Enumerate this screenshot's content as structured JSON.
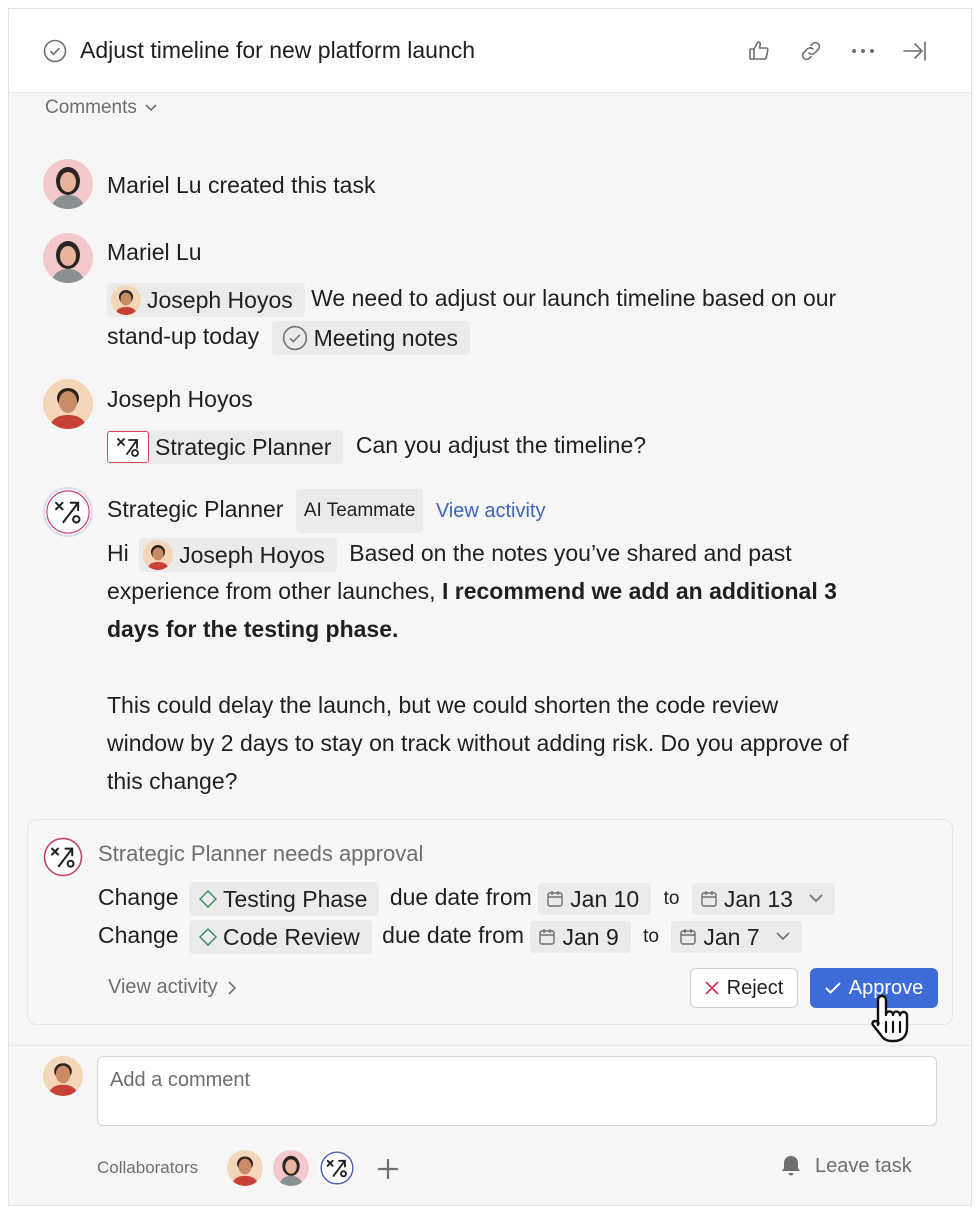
{
  "header": {
    "title": "Adjust timeline for new platform launch",
    "icons": [
      "check-circle-icon",
      "thumbs-up-icon",
      "link-icon",
      "more-icon",
      "close-pane-icon"
    ]
  },
  "comments_toggle": {
    "label": "Comments"
  },
  "feed": {
    "created": {
      "author": "Mariel Lu",
      "text": "Mariel Lu created this task"
    },
    "comment1": {
      "author": "Mariel Lu",
      "mention": "Joseph Hoyos",
      "text_a": "We need to adjust our launch timeline based on our",
      "text_b": "stand-up today",
      "attachment": "Meeting notes"
    },
    "comment2": {
      "author": "Joseph Hoyos",
      "mention": "Strategic Planner",
      "text": "Can you adjust the timeline?"
    },
    "comment3": {
      "author": "Strategic Planner",
      "badge": "AI Teammate",
      "link": "View activity",
      "greeting": "Hi",
      "mention": "Joseph Hoyos",
      "text_a": "Based on the notes you’ve shared and past",
      "text_b": "experience from other launches,",
      "bold_a": "I recommend we add an additional 3",
      "bold_b": "days for the testing phase.",
      "para2_a": "This could delay the launch, but we could shorten the code review",
      "para2_b": "window by 2 days to stay on track without adding risk. Do you approve of",
      "para2_c": "this change?"
    }
  },
  "approval": {
    "agent": "Strategic Planner",
    "status": "needs approval",
    "rows": [
      {
        "verb": "Change",
        "item": "Testing Phase",
        "middle": "due date from",
        "from": "Jan 10",
        "to_word": "to",
        "to": "Jan 13"
      },
      {
        "verb": "Change",
        "item": "Code Review",
        "middle": "due date from",
        "from": "Jan 9",
        "to_word": "to",
        "to": "Jan 7"
      }
    ],
    "view_activity": "View activity",
    "reject": "Reject",
    "approve": "Approve",
    "colors": {
      "approve_bg": "#3f6bd6",
      "reject_x": "#d1395a",
      "link": "#3e64b6"
    }
  },
  "composer": {
    "placeholder": "Add a comment",
    "collaborators_label": "Collaborators",
    "leave": "Leave task"
  }
}
